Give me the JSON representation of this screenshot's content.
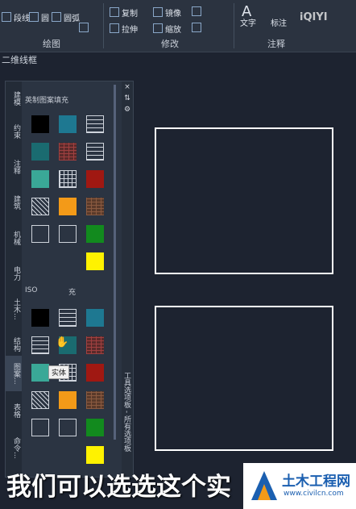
{
  "ribbon": {
    "draw": {
      "label": "绘图",
      "items": [
        "段线",
        "圆",
        "圆弧"
      ]
    },
    "modify": {
      "label": "修改",
      "items": [
        "复制",
        "镜像",
        "拉伸",
        "缩放"
      ]
    },
    "annotate": {
      "label": "注释",
      "items": [
        "文字",
        "标注"
      ]
    }
  },
  "drawing_tab": "二维线框",
  "palette": {
    "tabs": [
      "建模",
      "约束",
      "注释",
      "建筑",
      "机械",
      "电力",
      "土木...",
      "结构",
      "图案...",
      "表格",
      "命令..."
    ],
    "active_tab": "图案...",
    "sections": [
      "英制图案填充",
      "ISO",
      "充"
    ],
    "tooltip": "实体",
    "side_icons": [
      "×",
      "⇅",
      "⚙"
    ],
    "side_label": "工具选项板 - 所有选项板"
  },
  "subtitle": "我们可以选选这个实",
  "logo": {
    "name": "土木工程网",
    "url": "www.civilcn.com"
  },
  "watermark": "iQIYI",
  "colors": {
    "black": "#000000",
    "teal": "#1e7891",
    "dark-teal": "#1a6b70",
    "light-teal": "#3aa897",
    "red": "#a01812",
    "orange": "#f39a18",
    "green": "#128a1e",
    "yellow": "#fff200"
  },
  "swatches_top": [
    "solid-black",
    "solid-teal",
    "brick",
    "solid-dark-teal",
    "red-brick",
    "brick",
    "solid-light-teal",
    "grid",
    "solid-red",
    "hatch",
    "solid-orange",
    "brown-brick",
    "dots",
    "dots",
    "solid-green",
    "solid-yellow"
  ],
  "swatches_bottom": [
    "solid-black",
    "brick",
    "solid-teal",
    "brick",
    "solid-dark-teal",
    "red-brick",
    "solid-light-teal",
    "grid",
    "solid-red",
    "hatch",
    "solid-orange",
    "brown-brick",
    "dots",
    "dots",
    "solid-green",
    "solid-yellow"
  ]
}
